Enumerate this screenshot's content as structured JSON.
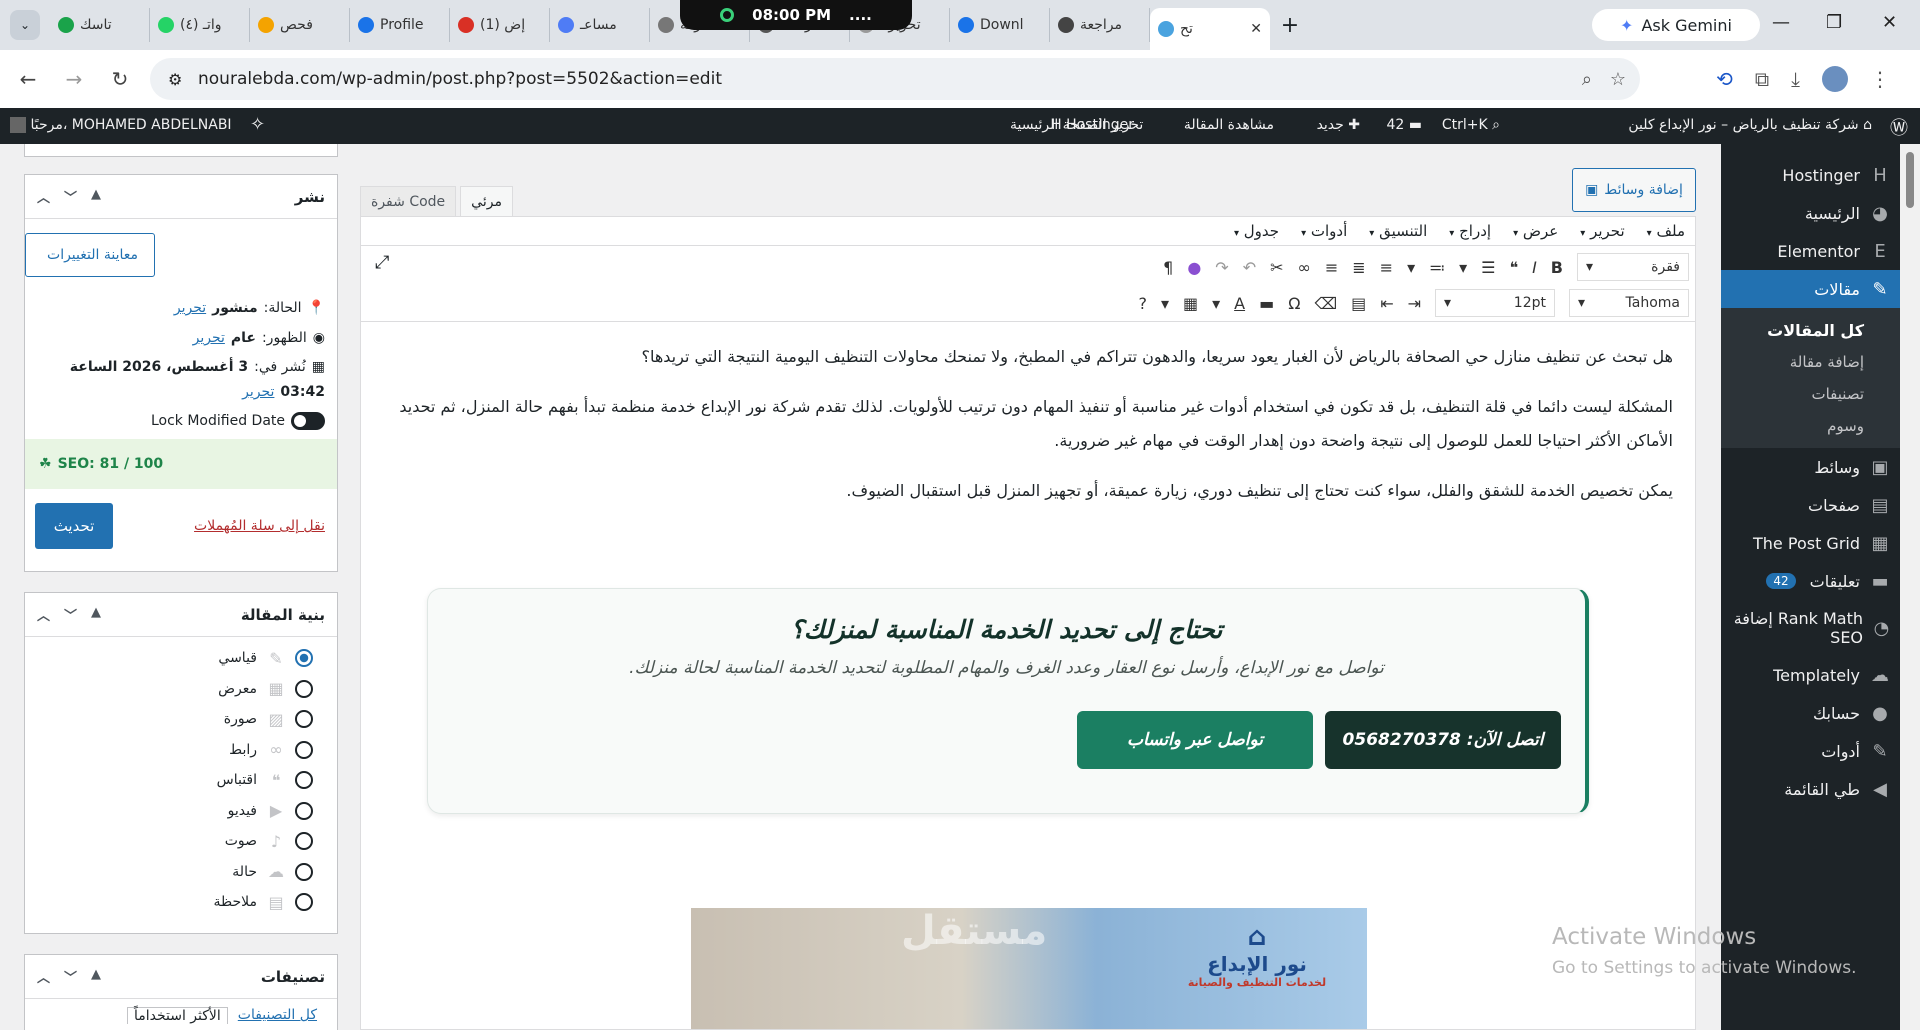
{
  "browser": {
    "tabs": [
      "تاسك",
      "واتـ (٤)",
      "فحص",
      "Profile",
      "(1) إض",
      "مساعـ",
      "شركة",
      "شركة د",
      "تحرير ا",
      "Downl",
      "مراجعة",
      "تح"
    ],
    "clock": "08:00 PM",
    "clock_dots": "....",
    "gemini_label": "Ask Gemini",
    "url": "nouralebda.com/wp-admin/post.php?post=5502&action=edit",
    "new_tab": "+"
  },
  "adminbar": {
    "site": "شركة تنظيف بالرياض – نور الإبداع كلين",
    "search_hint": "Ctrl+K",
    "comments": "42",
    "new": "جديد",
    "view": "مشاهدة المقالة",
    "hostinger": "Hostinger",
    "edit_home": "تحرير الصفحة الرئيسية",
    "greeting": "مرحبًا، MOHAMED ABDELNABI"
  },
  "menu": {
    "items": [
      {
        "label": "Hostinger",
        "icon": "H"
      },
      {
        "label": "الرئيسية",
        "icon": "◕"
      },
      {
        "label": "Elementor",
        "icon": "E"
      }
    ],
    "posts": "مقالات",
    "sub": [
      "كل المقالات",
      "إضافة مقالة",
      "تصنيفات",
      "وسوم"
    ],
    "items2": [
      {
        "label": "وسائط",
        "icon": "▣"
      },
      {
        "label": "صفحات",
        "icon": "▤"
      },
      {
        "label": "The Post Grid",
        "icon": "▦"
      },
      {
        "label": "تعليقات",
        "icon": "▬",
        "badge": "42"
      },
      {
        "label": "Rank Math إضافة SEO",
        "icon": "◔"
      },
      {
        "label": "Templately",
        "icon": "☁"
      },
      {
        "label": "حسابك",
        "icon": "●"
      },
      {
        "label": "أدوات",
        "icon": "✎"
      },
      {
        "label": "طي القائمة",
        "icon": "◀"
      }
    ]
  },
  "editor": {
    "add_media": "إضافة وسائط",
    "tab_visual": "مرئي",
    "tab_code": "شفرة Code",
    "menubar": [
      "ملف",
      "تحرير",
      "عرض",
      "إدراج",
      "التنسيق",
      "أدوات",
      "جدول"
    ],
    "paragraph": "فقرة",
    "font": "Tahoma",
    "size": "12pt",
    "paragraphs": [
      "هل تبحث عن تنظيف منازل حي الصحافة بالرياض لأن الغبار يعود سريعا، والدهون تتراكم في المطبخ، ولا تمنحك محاولات التنظيف اليومية النتيجة التي تريدها؟",
      "المشكلة ليست دائما في قلة التنظيف، بل قد تكون في استخدام أدوات غير مناسبة أو تنفيذ المهام دون ترتيب للأولويات. لذلك تقدم شركة نور الإبداع خدمة منظمة تبدأ بفهم حالة المنزل، ثم تحديد الأماكن الأكثر احتياجا للعمل للوصول إلى نتيجة واضحة دون إهدار الوقت في مهام غير ضرورية.",
      "يمكن تخصيص الخدمة للشقق والفلل، سواء كنت تحتاج إلى تنظيف دوري، زيارة عميقة، أو تجهيز المنزل قبل استقبال الضيوف."
    ],
    "cta": {
      "title": "تحتاج إلى تحديد الخدمة المناسبة لمنزلك؟",
      "subtitle": "تواصل مع نور الإبداع، وأرسل نوع العقار وعدد الغرف والمهام المطلوبة لتحديد الخدمة المناسبة لحالة منزلك.",
      "call": "اتصل الآن: 0568270378",
      "whatsapp": "تواصل عبر واتساب",
      "call_color": "#17332c",
      "wa_color": "#1b7f62"
    },
    "image_logo": "نور الإبداع",
    "image_logo_sub": "لخدمات التنظيف والصيانة",
    "watermark": "مستقل"
  },
  "publish": {
    "title": "نشر",
    "preview": "معاينة التغييرات",
    "status_label": "الحالة:",
    "status": "منشور",
    "edit": "تحرير",
    "visibility_label": "الظهور:",
    "visibility": "عام",
    "published_label": "نُشر في:",
    "published": "3 أغسطس، 2026 الساعة",
    "published_time": "03:42",
    "lock": "Lock Modified Date",
    "seo": "SEO: 81 / 100",
    "trash": "نقل إلى سلة المُهملات",
    "update": "تحديث"
  },
  "format": {
    "title": "بنية المقالة",
    "options": [
      "قياسي",
      "معرض",
      "صورة",
      "رابط",
      "اقتباس",
      "فيديو",
      "صوت",
      "حالة",
      "ملاحظة"
    ],
    "icons": [
      "✎",
      "▦",
      "▨",
      "∞",
      "❝",
      "▶",
      "♪",
      "☁",
      "▤"
    ],
    "selected": 0
  },
  "categories": {
    "title": "تصنيفات",
    "all": "كل التصنيفات",
    "most": "الأكثر استخداماً"
  },
  "windows": {
    "activate": "Activate Windows",
    "activate_sub": "Go to Settings to activate Windows."
  }
}
